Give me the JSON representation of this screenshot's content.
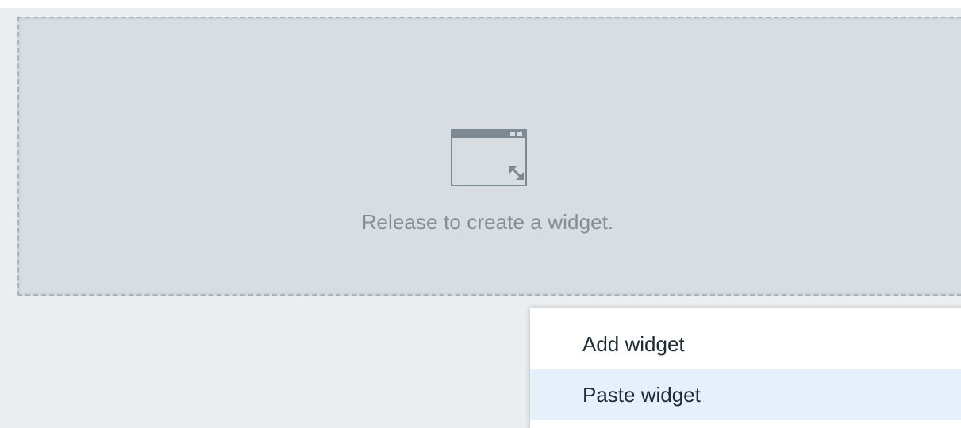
{
  "placeholder": {
    "message": "Release to create a widget.",
    "icon": "widget-resize-icon"
  },
  "context_menu": {
    "items": [
      {
        "label": "Add widget",
        "highlighted": false
      },
      {
        "label": "Paste widget",
        "highlighted": true
      }
    ],
    "highlight_color": "#e5f0fb"
  },
  "colors": {
    "background": "#ebeef0",
    "placeholder_fill": "#d8dde1",
    "placeholder_border": "#a9b4bb",
    "placeholder_text": "#838e96",
    "menu_text": "#1f2c33"
  }
}
